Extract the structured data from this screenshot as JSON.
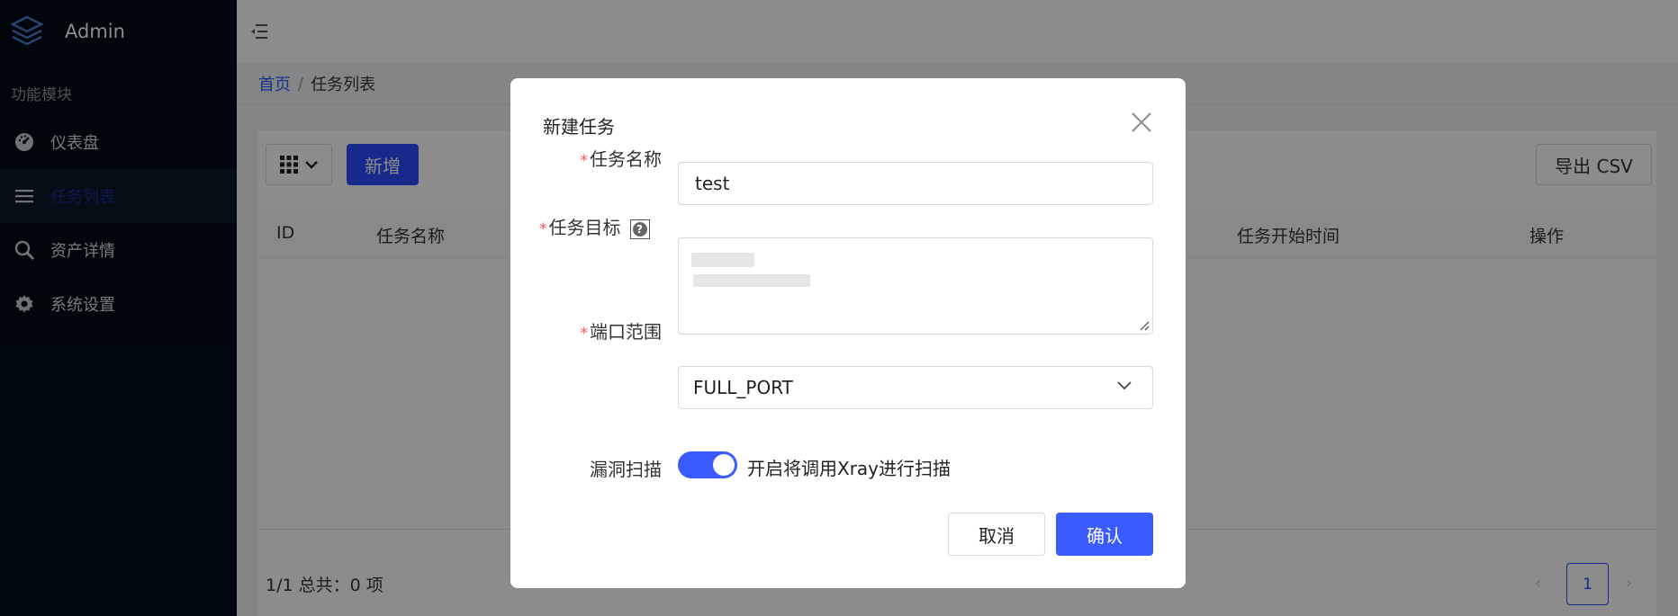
{
  "app": {
    "title": "Admin"
  },
  "sidebar": {
    "group_title": "功能模块",
    "items": [
      {
        "label": "仪表盘",
        "icon": "dashboard-icon"
      },
      {
        "label": "任务列表",
        "icon": "list-icon",
        "active": true
      },
      {
        "label": "资产详情",
        "icon": "search-icon"
      },
      {
        "label": "系统设置",
        "icon": "gear-icon"
      }
    ]
  },
  "breadcrumb": {
    "home": "首页",
    "separator": "/",
    "current": "任务列表"
  },
  "toolbar": {
    "add_label": "新增",
    "export_label": "导出 CSV"
  },
  "table": {
    "columns": [
      "ID",
      "任务名称",
      "任务开始时间",
      "操作"
    ]
  },
  "pagination": {
    "summary": "1/1 总共：0 项",
    "current_page": "1",
    "prev": "‹",
    "next": "›"
  },
  "modal": {
    "title": "新建任务",
    "fields": {
      "name": {
        "label": "任务名称",
        "value": "test"
      },
      "target": {
        "label": "任务目标",
        "help": "?"
      },
      "port": {
        "label": "端口范围",
        "value": "FULL_PORT"
      },
      "vuln": {
        "label": "漏洞扫描",
        "switch_on": true,
        "switch_text": "开启将调用Xray进行扫描"
      }
    },
    "required_mark": "*",
    "cancel_label": "取消",
    "ok_label": "确认"
  },
  "colors": {
    "primary": "#3a5bff",
    "sidebar_bg": "#000c17",
    "required": "#ff4d4f"
  }
}
